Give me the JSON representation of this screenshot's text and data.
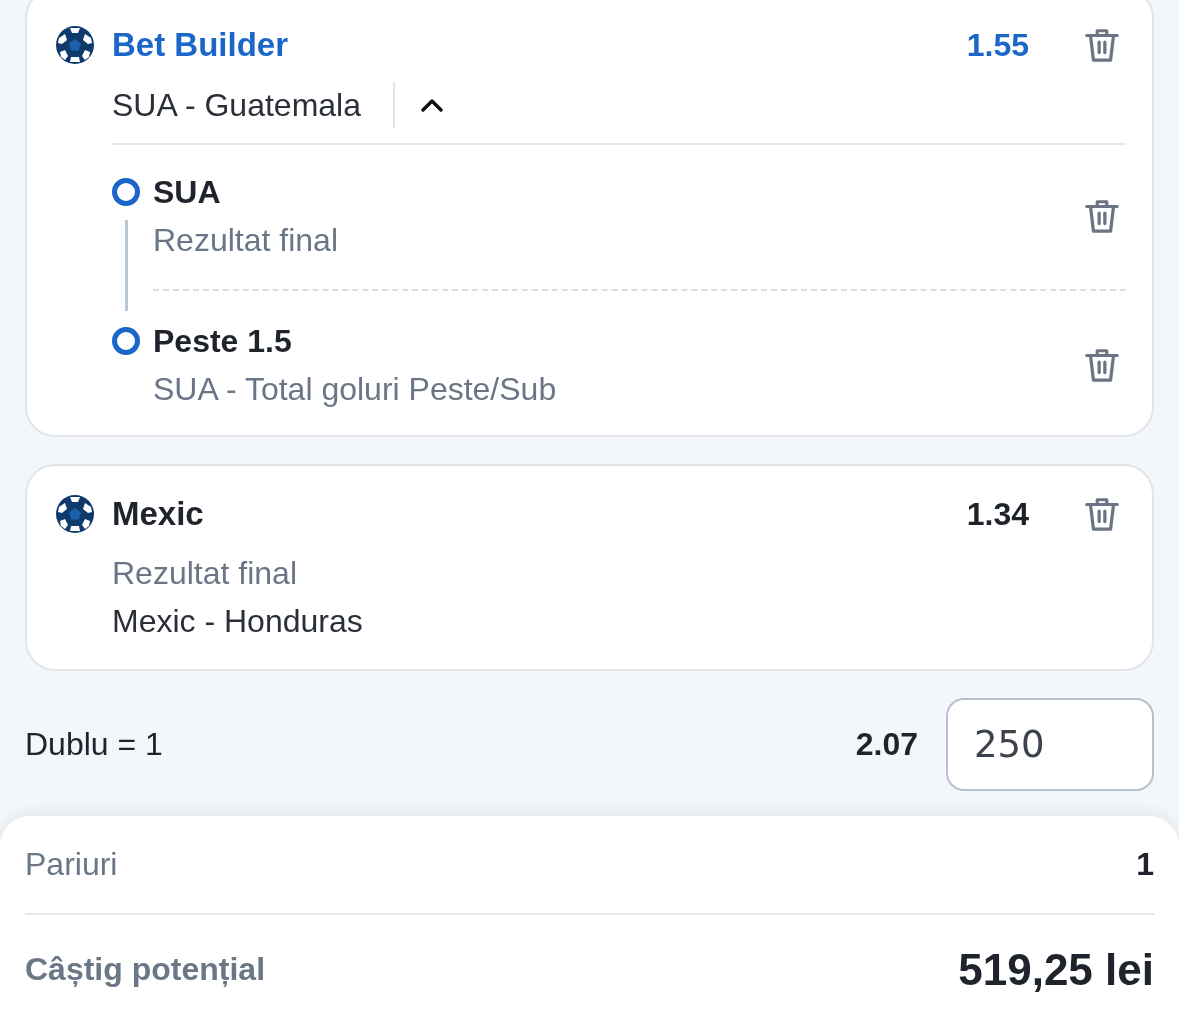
{
  "selections": [
    {
      "kind": "bet_builder",
      "title": "Bet Builder",
      "odds": "1.55",
      "match": "SUA - Guatemala",
      "expanded": true,
      "legs": [
        {
          "pick": "SUA",
          "market": "Rezultat final"
        },
        {
          "pick": "Peste 1.5",
          "market": "SUA - Total goluri Peste/Sub"
        }
      ]
    },
    {
      "kind": "single",
      "title": "Mexic",
      "odds": "1.34",
      "market": "Rezultat final",
      "match": "Mexic - Honduras"
    }
  ],
  "stake_row": {
    "label": "Dublu = 1",
    "odds": "2.07",
    "stake": "250"
  },
  "summary": [
    {
      "kind": "count",
      "label": "Pariuri",
      "value": "1"
    },
    {
      "kind": "payout",
      "label": "Câștig potențial",
      "value": "519,25 lei"
    }
  ]
}
